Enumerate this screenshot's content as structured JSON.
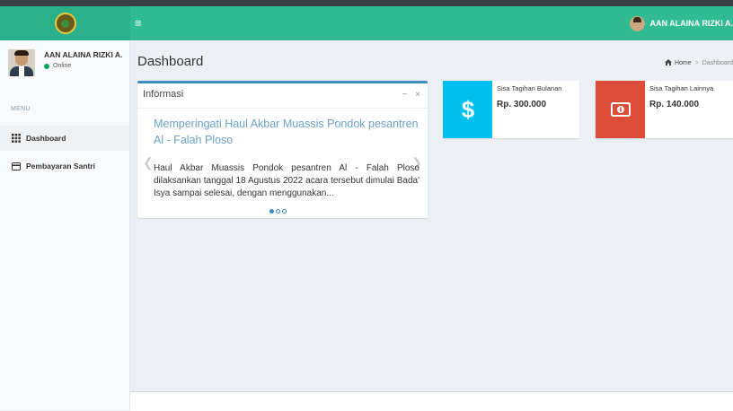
{
  "header": {
    "menu_toggle": "≡",
    "user_name": "AAN ALAINA RIZKI A."
  },
  "sidebar": {
    "user_name": "AAN ALAINA RIZKI A.",
    "status": "Online",
    "menu_header": "MENU",
    "items": [
      {
        "label": "Dashboard",
        "icon": "grid-icon",
        "active": true
      },
      {
        "label": "Pembayaran Santri",
        "icon": "credit-card-icon",
        "active": false
      }
    ]
  },
  "content": {
    "title": "Dashboard",
    "breadcrumb": [
      "Home",
      "Dashboard"
    ]
  },
  "info_panel": {
    "title": "Informasi",
    "tools": [
      "−",
      "×"
    ],
    "slide": {
      "title": "Memperingati Haul Akbar Muassis Pondok pesantren Al - Falah Ploso",
      "text": "Haul Akbar Muassis Pondok pesantren Al - Falah Ploso dilaksankan tanggal 18 Agustus 2022 acara tersebut dimulai Bada' Isya sampai selesai, dengan menggunakan..."
    },
    "slide_count": 3,
    "active_slide": 1
  },
  "info_boxes": [
    {
      "label": "Sisa Tagihan Bulanan",
      "value": "Rp. 300.000",
      "color": "#00c0ef",
      "icon": "dollar-icon"
    },
    {
      "label": "Sisa Tagihan Lainnya",
      "value": "Rp. 140.000",
      "color": "#dd4b39",
      "icon": "money-icon"
    }
  ],
  "colors": {
    "header": "#30bb93",
    "logo_bg": "#2ab08a",
    "box_border": "#3c8dbc",
    "online": "#00a65a"
  }
}
